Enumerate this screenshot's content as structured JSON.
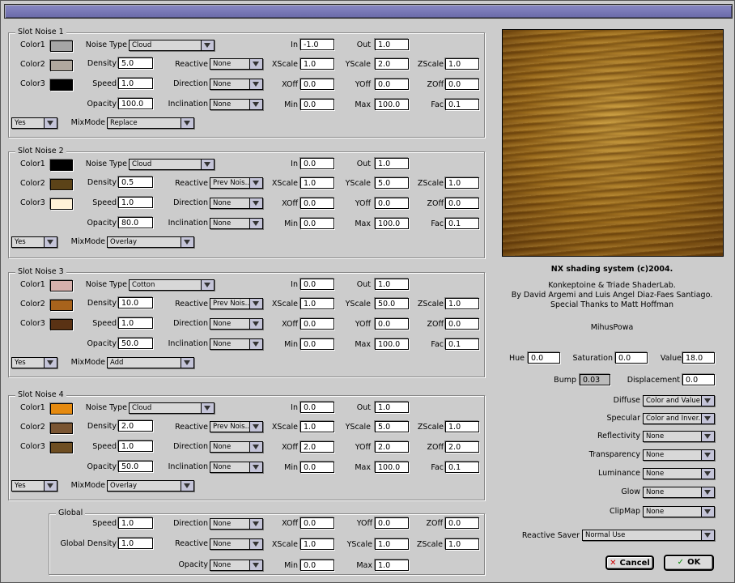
{
  "window": {
    "title": ""
  },
  "labels": {
    "color1": "Color1",
    "color2": "Color2",
    "color3": "Color3",
    "noise_type": "Noise Type",
    "density": "Density",
    "speed": "Speed",
    "opacity": "Opacity",
    "reactive": "Reactive",
    "direction": "Direction",
    "inclination": "Inclination",
    "in": "In",
    "out": "Out",
    "xscale": "XScale",
    "yscale": "YScale",
    "zscale": "ZScale",
    "xoff": "XOff",
    "yoff": "YOff",
    "zoff": "ZOff",
    "min": "Min",
    "max": "Max",
    "fac": "Fac",
    "mixmode": "MixMode",
    "global_density": "Global Density"
  },
  "slots": [
    {
      "title": "Slot Noise 1",
      "colors": [
        "#a6a6a6",
        "#b0a89e",
        "#000000"
      ],
      "noise_type": "Cloud",
      "density": "5.0",
      "speed": "1.0",
      "opacity": "100.0",
      "reactive": "None",
      "direction": "None",
      "inclination": "None",
      "in": "-1.0",
      "out": "1.0",
      "xscale": "1.0",
      "yscale": "2.0",
      "zscale": "1.0",
      "xoff": "0.0",
      "yoff": "0.0",
      "zoff": "0.0",
      "min": "0.0",
      "max": "100.0",
      "fac": "0.1",
      "enabled": "Yes",
      "mixmode": "Replace"
    },
    {
      "title": "Slot Noise 2",
      "colors": [
        "#000000",
        "#5c4318",
        "#fff2d8"
      ],
      "noise_type": "Cloud",
      "density": "0.5",
      "speed": "1.0",
      "opacity": "80.0",
      "reactive": "Prev Nois...",
      "direction": "None",
      "inclination": "None",
      "in": "0.0",
      "out": "1.0",
      "xscale": "1.0",
      "yscale": "5.0",
      "zscale": "1.0",
      "xoff": "0.0",
      "yoff": "0.0",
      "zoff": "0.0",
      "min": "0.0",
      "max": "100.0",
      "fac": "0.1",
      "enabled": "Yes",
      "mixmode": "Overlay"
    },
    {
      "title": "Slot Noise 3",
      "colors": [
        "#d6b0ac",
        "#a8631c",
        "#5a3214"
      ],
      "noise_type": "Cotton",
      "density": "10.0",
      "speed": "1.0",
      "opacity": "50.0",
      "reactive": "Prev Nois...",
      "direction": "None",
      "inclination": "None",
      "in": "0.0",
      "out": "1.0",
      "xscale": "1.0",
      "yscale": "50.0",
      "zscale": "1.0",
      "xoff": "0.0",
      "yoff": "0.0",
      "zoff": "0.0",
      "min": "0.0",
      "max": "100.0",
      "fac": "0.1",
      "enabled": "Yes",
      "mixmode": "Add"
    },
    {
      "title": "Slot Noise 4",
      "colors": [
        "#e58a10",
        "#7a5532",
        "#6e4e22"
      ],
      "noise_type": "Cloud",
      "density": "2.0",
      "speed": "1.0",
      "opacity": "50.0",
      "reactive": "Prev Nois...",
      "direction": "None",
      "inclination": "None",
      "in": "0.0",
      "out": "1.0",
      "xscale": "1.0",
      "yscale": "5.0",
      "zscale": "1.0",
      "xoff": "2.0",
      "yoff": "2.0",
      "zoff": "2.0",
      "min": "0.0",
      "max": "100.0",
      "fac": "0.1",
      "enabled": "Yes",
      "mixmode": "Overlay"
    }
  ],
  "global": {
    "title": "Global",
    "speed": "1.0",
    "density": "1.0",
    "direction": "None",
    "reactive": "None",
    "opacity": "None",
    "xoff": "0.0",
    "yoff": "0.0",
    "zoff": "0.0",
    "xscale": "1.0",
    "yscale": "1.0",
    "zscale": "1.0",
    "min": "0.0",
    "max": "1.0"
  },
  "info": {
    "title": "NX shading system (c)2004.",
    "line1": "Konkeptoine & Triade ShaderLab.",
    "line2": "By David Argemi and Luis Angel Diaz-Faes Santiago.",
    "line3": "Special Thanks to Matt Hoffman",
    "name": "MihusPowa"
  },
  "params": {
    "hue_label": "Hue",
    "hue": "0.0",
    "saturation_label": "Saturation",
    "saturation": "0.0",
    "value_label": "Value",
    "value": "18.0",
    "bump_label": "Bump",
    "bump": "0.03",
    "displacement_label": "Displacement",
    "displacement": "0.0"
  },
  "channels": [
    {
      "label": "Diffuse",
      "value": "Color and Value"
    },
    {
      "label": "Specular",
      "value": "Color and Inver..."
    },
    {
      "label": "Reflectivity",
      "value": "None"
    },
    {
      "label": "Transparency",
      "value": "None"
    },
    {
      "label": "Luminance",
      "value": "None"
    },
    {
      "label": "Glow",
      "value": "None"
    },
    {
      "label": "ClipMap",
      "value": "None"
    }
  ],
  "reactive_saver": {
    "label": "Reactive Saver",
    "value": "Normal Use"
  },
  "buttons": {
    "cancel": "Cancel",
    "ok": "OK",
    "cancel_icon": "x-icon",
    "ok_icon": "check-icon"
  }
}
